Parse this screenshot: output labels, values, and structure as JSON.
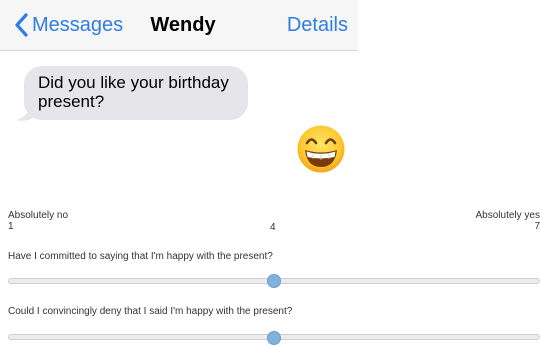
{
  "header": {
    "back_label": "Messages",
    "contact_name": "Wendy",
    "details_label": "Details"
  },
  "message": {
    "text_line1": "Did you like your birthday",
    "text_line2": "present?",
    "reply_emoji": "grinning-face-with-smiling-eyes"
  },
  "scale": {
    "low_label": "Absolutely no",
    "low_value": "1",
    "mid_value": "4",
    "high_label": "Absolutely yes",
    "high_value": "7",
    "min": 1,
    "max": 7
  },
  "questions": [
    {
      "text": "Have I committed to saying that I'm happy with the present?",
      "value": 4
    },
    {
      "text": "Could I convincingly deny that I said I'm happy with the present?",
      "value": 4
    }
  ],
  "colors": {
    "ios_blue": "#2f7de1",
    "bubble_gray": "#e5e5ea",
    "slider_thumb": "#7fb2de"
  }
}
